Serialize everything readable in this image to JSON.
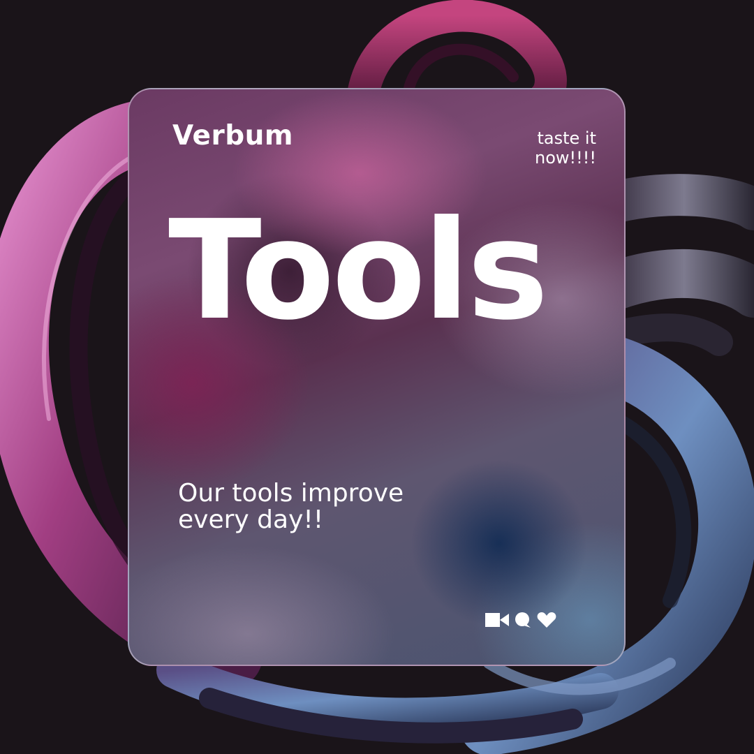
{
  "brand": "Verbum",
  "tagline": "taste it now!!!!",
  "headline": "Tools",
  "subtitle": "Our tools improve every day!!",
  "icons": [
    "video-camera-icon",
    "speech-bubble-icon",
    "heart-icon"
  ],
  "colors": {
    "background": "#1a1419",
    "text": "#ffffff",
    "ribbon_pink": "#b0508f",
    "ribbon_blue": "#4f6f9e"
  }
}
